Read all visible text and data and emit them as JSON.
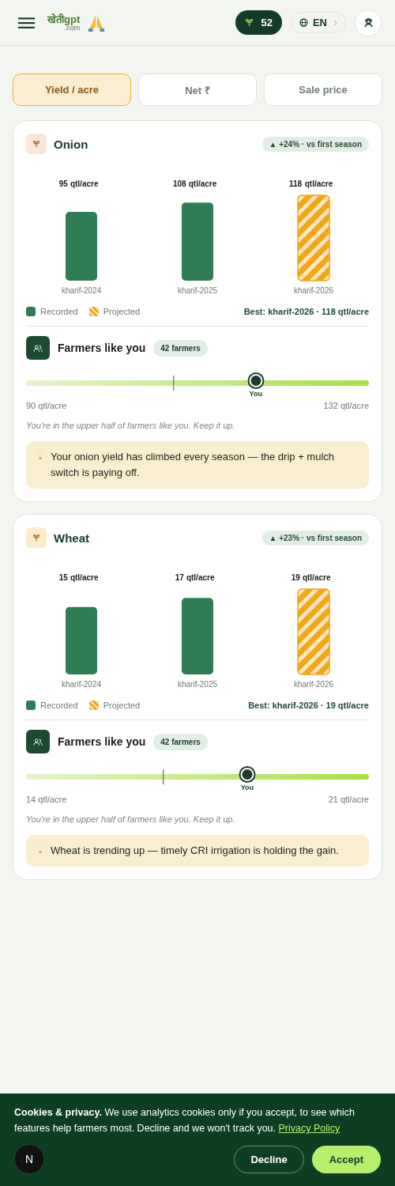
{
  "header": {
    "logo": {
      "name": "खेतीgpt",
      "domain": ".com"
    },
    "points": "52",
    "language": "EN"
  },
  "tabs": [
    {
      "label": "Yield / acre",
      "selected": true
    },
    {
      "label": "Net ₹",
      "selected": false
    },
    {
      "label": "Sale price",
      "selected": false
    }
  ],
  "crops": [
    {
      "name": "Onion",
      "kind": "onion",
      "change": "▲ +24% · vs first season",
      "chart_data": {
        "type": "bar",
        "categories": [
          "kharif-2024",
          "kharif-2025",
          "kharif-2026"
        ],
        "series": [
          {
            "name": "Recorded",
            "color": "#2e7d55",
            "values": [
              95,
              108,
              null
            ]
          },
          {
            "name": "Projected",
            "color": "#f2a71b",
            "values": [
              null,
              null,
              118
            ]
          }
        ],
        "data_labels": true
      },
      "value_units": [
        "qtl/acre",
        "qtl/acre",
        "qtl/acre"
      ],
      "best": "Best: kharif-2026 · 118 qtl/acre",
      "peers": {
        "title": "Farmers like you",
        "count": "42 farmers",
        "median": {
          "level": 0.43
        },
        "you": {
          "label": "You",
          "level": 0.67
        },
        "min": "90 qtl/acre",
        "max": "132 qtl/acre",
        "note": "You're in the upper half of farmers like you. Keep it up."
      },
      "tip": "Your onion yield has climbed every season — the drip + mulch switch is paying off."
    },
    {
      "name": "Wheat",
      "kind": "wheat",
      "change": "▲ +23% · vs first season",
      "chart_data": {
        "type": "bar",
        "categories": [
          "kharif-2024",
          "kharif-2025",
          "kharif-2026"
        ],
        "series": [
          {
            "name": "Recorded",
            "color": "#2e7d55",
            "values": [
              15,
              17,
              null
            ]
          },
          {
            "name": "Projected",
            "color": "#f2a71b",
            "values": [
              null,
              null,
              19
            ]
          }
        ],
        "data_labels": true
      },
      "value_units": [
        "qtl/acre",
        "qtl/acre",
        "qtl/acre"
      ],
      "best": "Best: kharif-2026 · 19 qtl/acre",
      "peers": {
        "title": "Farmers like you",
        "count": "42 farmers",
        "median": {
          "level": 0.4
        },
        "you": {
          "label": "You",
          "level": 0.645
        },
        "min": "14 qtl/acre",
        "max": "21 qtl/acre",
        "note": "You're in the upper half of farmers like you. Keep it up."
      },
      "tip": "Wheat is trending up — timely CRI irrigation is holding the gain."
    }
  ],
  "cookie_banner": {
    "text": "**Cookies & privacy.** We use analytics cookies only if you accept, to see which features help farmers most. Decline and we won't track you.",
    "link": "Privacy Policy",
    "buttons": [
      {
        "label": "Decline",
        "kind": "secondary"
      },
      {
        "label": "Accept",
        "kind": "primary"
      }
    ]
  },
  "dev_badge": "N"
}
